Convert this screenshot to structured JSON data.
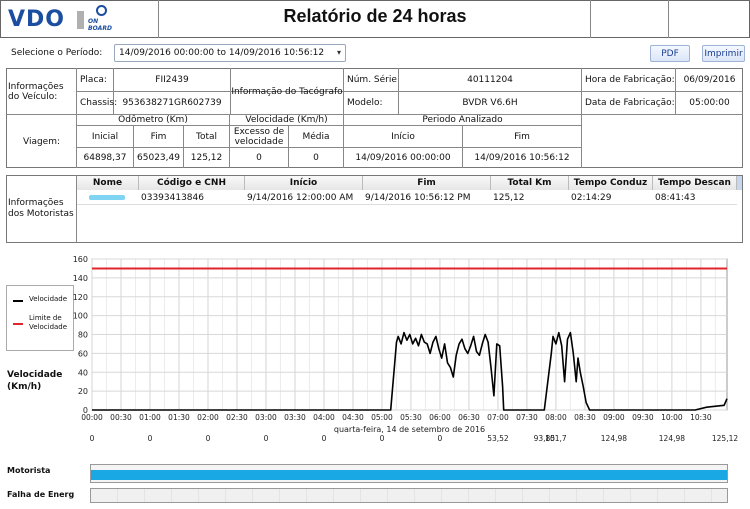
{
  "header": {
    "logo_text": "VDO",
    "onboard_text": "ON BOARD",
    "title": "Relatório de 24 horas"
  },
  "period": {
    "label": "Selecione o Período:",
    "value": "14/09/2016 00:00:00 to 14/09/2016 10:56:12"
  },
  "buttons": {
    "pdf": "PDF",
    "print": "Imprimir"
  },
  "vehicle": {
    "section_label": "Informações do Veículo:",
    "plate_label": "Placa:",
    "plate": "FII2439",
    "chassis_label": "Chassis:",
    "chassis": "953638271GR602739",
    "tacho_label": "Informação do Tacógrafo",
    "serial_label": "Núm. Série",
    "serial": "40111204",
    "model_label": "Modelo:",
    "model": "BVDR V6.6H",
    "mfg_time_label": "Hora de Fabricação:",
    "mfg_time": "06/09/2016",
    "mfg_date_label": "Data de Fabricação:",
    "mfg_date": "05:00:00"
  },
  "trip": {
    "section_label": "Viagem:",
    "odometer_label": "Odômetro (Km)",
    "speed_label": "Velocidade (Km/h)",
    "period_label": "Periodo Analizado",
    "initial_label": "Inicial",
    "end_label": "Fim",
    "total_label": "Total",
    "excess_label": "Excesso de velocidade",
    "avg_label": "Média",
    "start_label": "Início",
    "period_end_label": "Fim",
    "initial": "64898,37",
    "end": "65023,49",
    "total": "125,12",
    "excess": "0",
    "avg": "0",
    "start": "14/09/2016 00:00:00",
    "period_end": "14/09/2016 10:56:12"
  },
  "drivers": {
    "section_label": "Informações dos Motoristas",
    "columns": [
      "Nome",
      "Código e CNH",
      "Início",
      "Fim",
      "Total Km",
      "Tempo Conduz",
      "Tempo Descan"
    ],
    "rows": [
      {
        "name": "",
        "code": "03393413846",
        "start": "9/14/2016 12:00:00 AM",
        "end": "9/14/2016 10:56:12 PM",
        "total": "125,12",
        "drive": "02:14:29",
        "rest": "08:41:43"
      }
    ]
  },
  "legend": {
    "speed": "Velocidade",
    "limit": "Limite de Velocidade"
  },
  "colors": {
    "speed": "#000000",
    "limit": "#e0262b",
    "driver_bar": "#1aa8e4",
    "name_chip": "#7fd4f4"
  },
  "chart_data": {
    "type": "line",
    "xlabel": "quarta-feira, 14 de setembro de 2016",
    "ylabel": "Velocidade (Km/h)",
    "ylim": [
      0,
      160
    ],
    "yticks": [
      "0",
      "20",
      "40",
      "60",
      "80",
      "100",
      "120",
      "140",
      "160"
    ],
    "xlim": [
      0,
      10.95
    ],
    "xticks": [
      "00:00",
      "00:30",
      "01:00",
      "01:30",
      "02:00",
      "02:30",
      "03:00",
      "03:30",
      "04:00",
      "04:30",
      "05:00",
      "05:30",
      "06:00",
      "06:30",
      "07:00",
      "07:30",
      "08:00",
      "08:30",
      "09:00",
      "09:30",
      "10:00",
      "10:30"
    ],
    "grid": true,
    "legend_position": "left",
    "speed_limit": 150,
    "series": [
      {
        "name": "Velocidade",
        "x": [
          0,
          5.15,
          5.25,
          5.28,
          5.33,
          5.38,
          5.43,
          5.48,
          5.53,
          5.58,
          5.63,
          5.68,
          5.73,
          5.78,
          5.83,
          5.88,
          5.93,
          5.98,
          6.03,
          6.08,
          6.13,
          6.18,
          6.23,
          6.28,
          6.33,
          6.38,
          6.43,
          6.48,
          6.53,
          6.58,
          6.63,
          6.68,
          6.73,
          6.78,
          6.83,
          6.88,
          6.93,
          6.98,
          7.03,
          7.08,
          7.1,
          7.8,
          7.92,
          7.95,
          8.0,
          8.05,
          8.1,
          8.15,
          8.2,
          8.25,
          8.3,
          8.35,
          8.38,
          8.42,
          8.47,
          8.52,
          8.58,
          10.4,
          10.6,
          10.9,
          10.95
        ],
        "y": [
          0,
          0,
          72,
          78,
          70,
          82,
          74,
          80,
          70,
          76,
          68,
          80,
          72,
          70,
          60,
          72,
          78,
          65,
          55,
          70,
          50,
          45,
          35,
          58,
          70,
          75,
          65,
          60,
          68,
          78,
          62,
          58,
          70,
          80,
          72,
          45,
          15,
          70,
          68,
          25,
          0,
          0,
          60,
          78,
          70,
          82,
          68,
          30,
          75,
          82,
          60,
          30,
          55,
          40,
          25,
          8,
          0,
          0,
          3,
          5,
          12
        ]
      },
      {
        "name": "Limite de Velocidade",
        "x": [
          0,
          10.95
        ],
        "y": [
          150,
          150
        ]
      }
    ],
    "cumulative_km_labels": [
      "0",
      "0",
      "0",
      "0",
      "0",
      "0",
      "0",
      "53,52",
      "93,85",
      "101,7",
      "124,98",
      "124,98",
      "125,12"
    ],
    "cumulative_km_hours": [
      0,
      1,
      2,
      3,
      4,
      5,
      6,
      7,
      7.8,
      8,
      9,
      10,
      10.95
    ],
    "timeline_tracks": [
      "Motorista",
      "Falha de Energ"
    ]
  }
}
